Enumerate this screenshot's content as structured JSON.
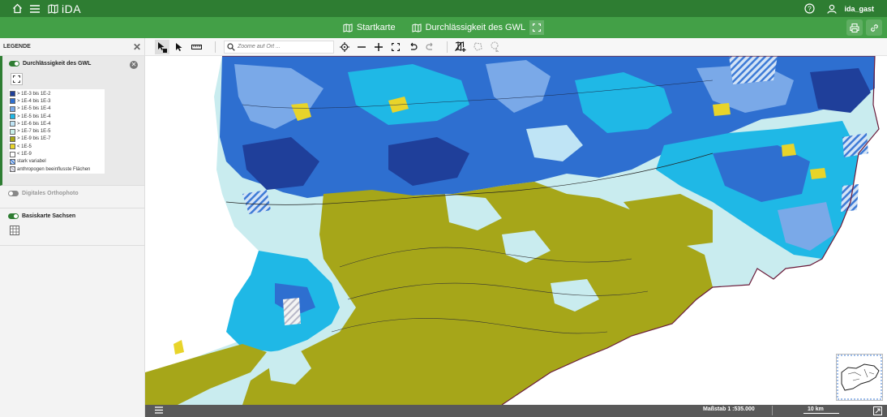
{
  "app": {
    "title": "iDA",
    "user": "ida_gast"
  },
  "subbar": {
    "home_label": "Startkarte",
    "layer_label": "Durchlässigkeit des GWL"
  },
  "legend": {
    "title": "LEGENDE",
    "layers": [
      {
        "name": "Durchlässigkeit des GWL",
        "enabled": true
      },
      {
        "name": "Digitales Orthophoto",
        "enabled": false
      },
      {
        "name": "Basiskarte Sachsen",
        "enabled": true
      }
    ],
    "items": [
      {
        "label": "> 1E-3 bis 1E-2",
        "color": "#1f3f9a"
      },
      {
        "label": "> 1E-4 bis 1E-3",
        "color": "#2e6fd0"
      },
      {
        "label": "> 1E-5 bis 1E-4",
        "color": "#7aa9e8"
      },
      {
        "label": "> 1E-5 bis 1E-4",
        "color": "#1fb8e6"
      },
      {
        "label": "> 1E-6 bis 1E-4",
        "color": "#bfe4f5"
      },
      {
        "label": "> 1E-7 bis 1E-5",
        "color": "#c9f0ea"
      },
      {
        "label": "> 1E-9 bis 1E-7",
        "color": "#a6a619"
      },
      {
        "label": "< 1E-5",
        "color": "#e8d42a"
      },
      {
        "label": "< 1E-9",
        "color": "#ffffff"
      },
      {
        "label": "stark variabel",
        "color": "hatch-blue"
      },
      {
        "label": "anthropogen beeinflusste Flächen",
        "color": "hatch-grey"
      }
    ]
  },
  "toolbar": {
    "search_placeholder": "Zoome auf Ort ..."
  },
  "status": {
    "scale": "Maßstab 1 :535.000",
    "distance": "10 km"
  },
  "colors": {
    "primary": "#2e7d32",
    "secondary": "#43a047"
  }
}
